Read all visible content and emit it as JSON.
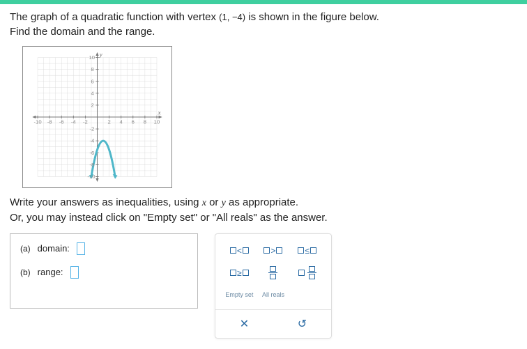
{
  "header_bar_color": "#3fcf9f",
  "problem": {
    "line1_a": "The graph of a quadratic function with vertex ",
    "vertex": "(1, −4)",
    "line1_b": " is shown in the figure below.",
    "line2": "Find the domain and the range."
  },
  "instructions": {
    "line1_a": "Write your answers as inequalities, using ",
    "var1": "x",
    "line1_b": " or ",
    "var2": "y",
    "line1_c": " as appropriate.",
    "line2": "Or, you may instead click on \"Empty set\" or \"All reals\" as the answer."
  },
  "answers": {
    "a_label": "(a)",
    "a_name": "domain:",
    "b_label": "(b)",
    "b_name": "range:"
  },
  "toolbox": {
    "lt": "<",
    "gt": ">",
    "le": "≤",
    "ge": "≥",
    "empty_set": "Empty set",
    "all_reals": "All reals",
    "clear": "✕",
    "reset": "↺"
  },
  "chart_data": {
    "type": "line",
    "title": "",
    "xlabel": "x",
    "ylabel": "y",
    "xlim": [
      -10,
      10
    ],
    "ylim": [
      -10,
      10
    ],
    "xticks": [
      -10,
      -8,
      -6,
      -4,
      -2,
      0,
      2,
      4,
      6,
      8,
      10
    ],
    "yticks": [
      -10,
      -8,
      -6,
      -4,
      -2,
      0,
      2,
      4,
      6,
      8,
      10
    ],
    "grid": true,
    "series": [
      {
        "name": "quadratic",
        "vertex": [
          1,
          -4
        ],
        "opens": "down",
        "approx_points_xy": [
          [
            -1,
            -10
          ],
          [
            0,
            -5.5
          ],
          [
            1,
            -4
          ],
          [
            2,
            -5.5
          ],
          [
            3,
            -10
          ]
        ],
        "color": "#4fb7c9",
        "arrows": "both-ends-down"
      }
    ]
  }
}
